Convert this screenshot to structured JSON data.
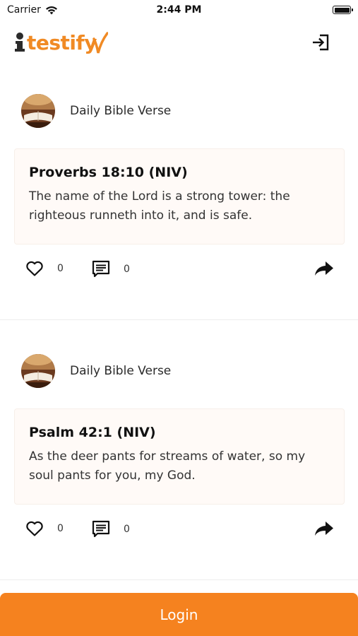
{
  "status_bar": {
    "carrier": "Carrier",
    "time": "2:44 PM"
  },
  "header": {
    "logo_text": "testify",
    "brand_color": "#f08a24",
    "logout_icon": "logout-icon"
  },
  "posts": [
    {
      "author": "Daily Bible Verse",
      "reference": "Proverbs 18:10 (NIV)",
      "text": "The name of the Lord is a strong tower: the righteous runneth into it, and is safe.",
      "likes": "0",
      "comments": "0"
    },
    {
      "author": "Daily Bible Verse",
      "reference": "Psalm 42:1 (NIV)",
      "text": "As the deer pants for streams of water, so my soul pants for you, my God.",
      "likes": "0",
      "comments": "0"
    }
  ],
  "login": {
    "label": "Login",
    "color": "#f5821f"
  }
}
